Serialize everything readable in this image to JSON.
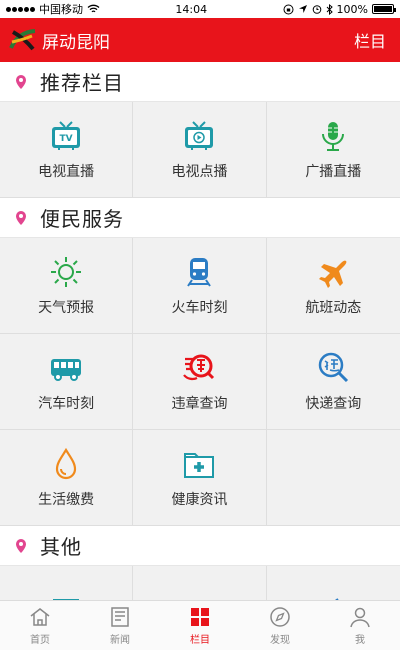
{
  "status_bar": {
    "carrier": "中国移动",
    "time": "14:04",
    "battery": "100%",
    "battery_level": 1.0
  },
  "header": {
    "title": "屏动昆阳",
    "menu_label": "栏目"
  },
  "sections": [
    {
      "title": "推荐栏目",
      "items": [
        {
          "label": "电视直播",
          "icon": "tv-live-icon"
        },
        {
          "label": "电视点播",
          "icon": "tv-vod-icon"
        },
        {
          "label": "广播直播",
          "icon": "microphone-icon"
        }
      ]
    },
    {
      "title": "便民服务",
      "items": [
        {
          "label": "天气预报",
          "icon": "sun-icon"
        },
        {
          "label": "火车时刻",
          "icon": "train-icon"
        },
        {
          "label": "航班动态",
          "icon": "airplane-icon"
        },
        {
          "label": "汽车时刻",
          "icon": "bus-icon"
        },
        {
          "label": "违章查询",
          "icon": "violation-icon"
        },
        {
          "label": "快递查询",
          "icon": "express-search-icon"
        },
        {
          "label": "生活缴费",
          "icon": "water-drop-icon"
        },
        {
          "label": "健康资讯",
          "icon": "medical-kit-icon"
        }
      ]
    },
    {
      "title": "其他"
    }
  ],
  "tabbar": [
    {
      "label": "首页",
      "icon": "home-icon",
      "active": false
    },
    {
      "label": "新闻",
      "icon": "news-icon",
      "active": false
    },
    {
      "label": "栏目",
      "icon": "grid-icon",
      "active": true
    },
    {
      "label": "发现",
      "icon": "compass-icon",
      "active": false
    },
    {
      "label": "我",
      "icon": "person-icon",
      "active": false
    }
  ],
  "colors": {
    "brand_red": "#e8141b",
    "pin_pink": "#e2458f",
    "icon_teal": "#1f9aa8",
    "icon_green": "#2aa84a",
    "icon_orange": "#f08a1c",
    "icon_blue": "#2b7cc4"
  }
}
